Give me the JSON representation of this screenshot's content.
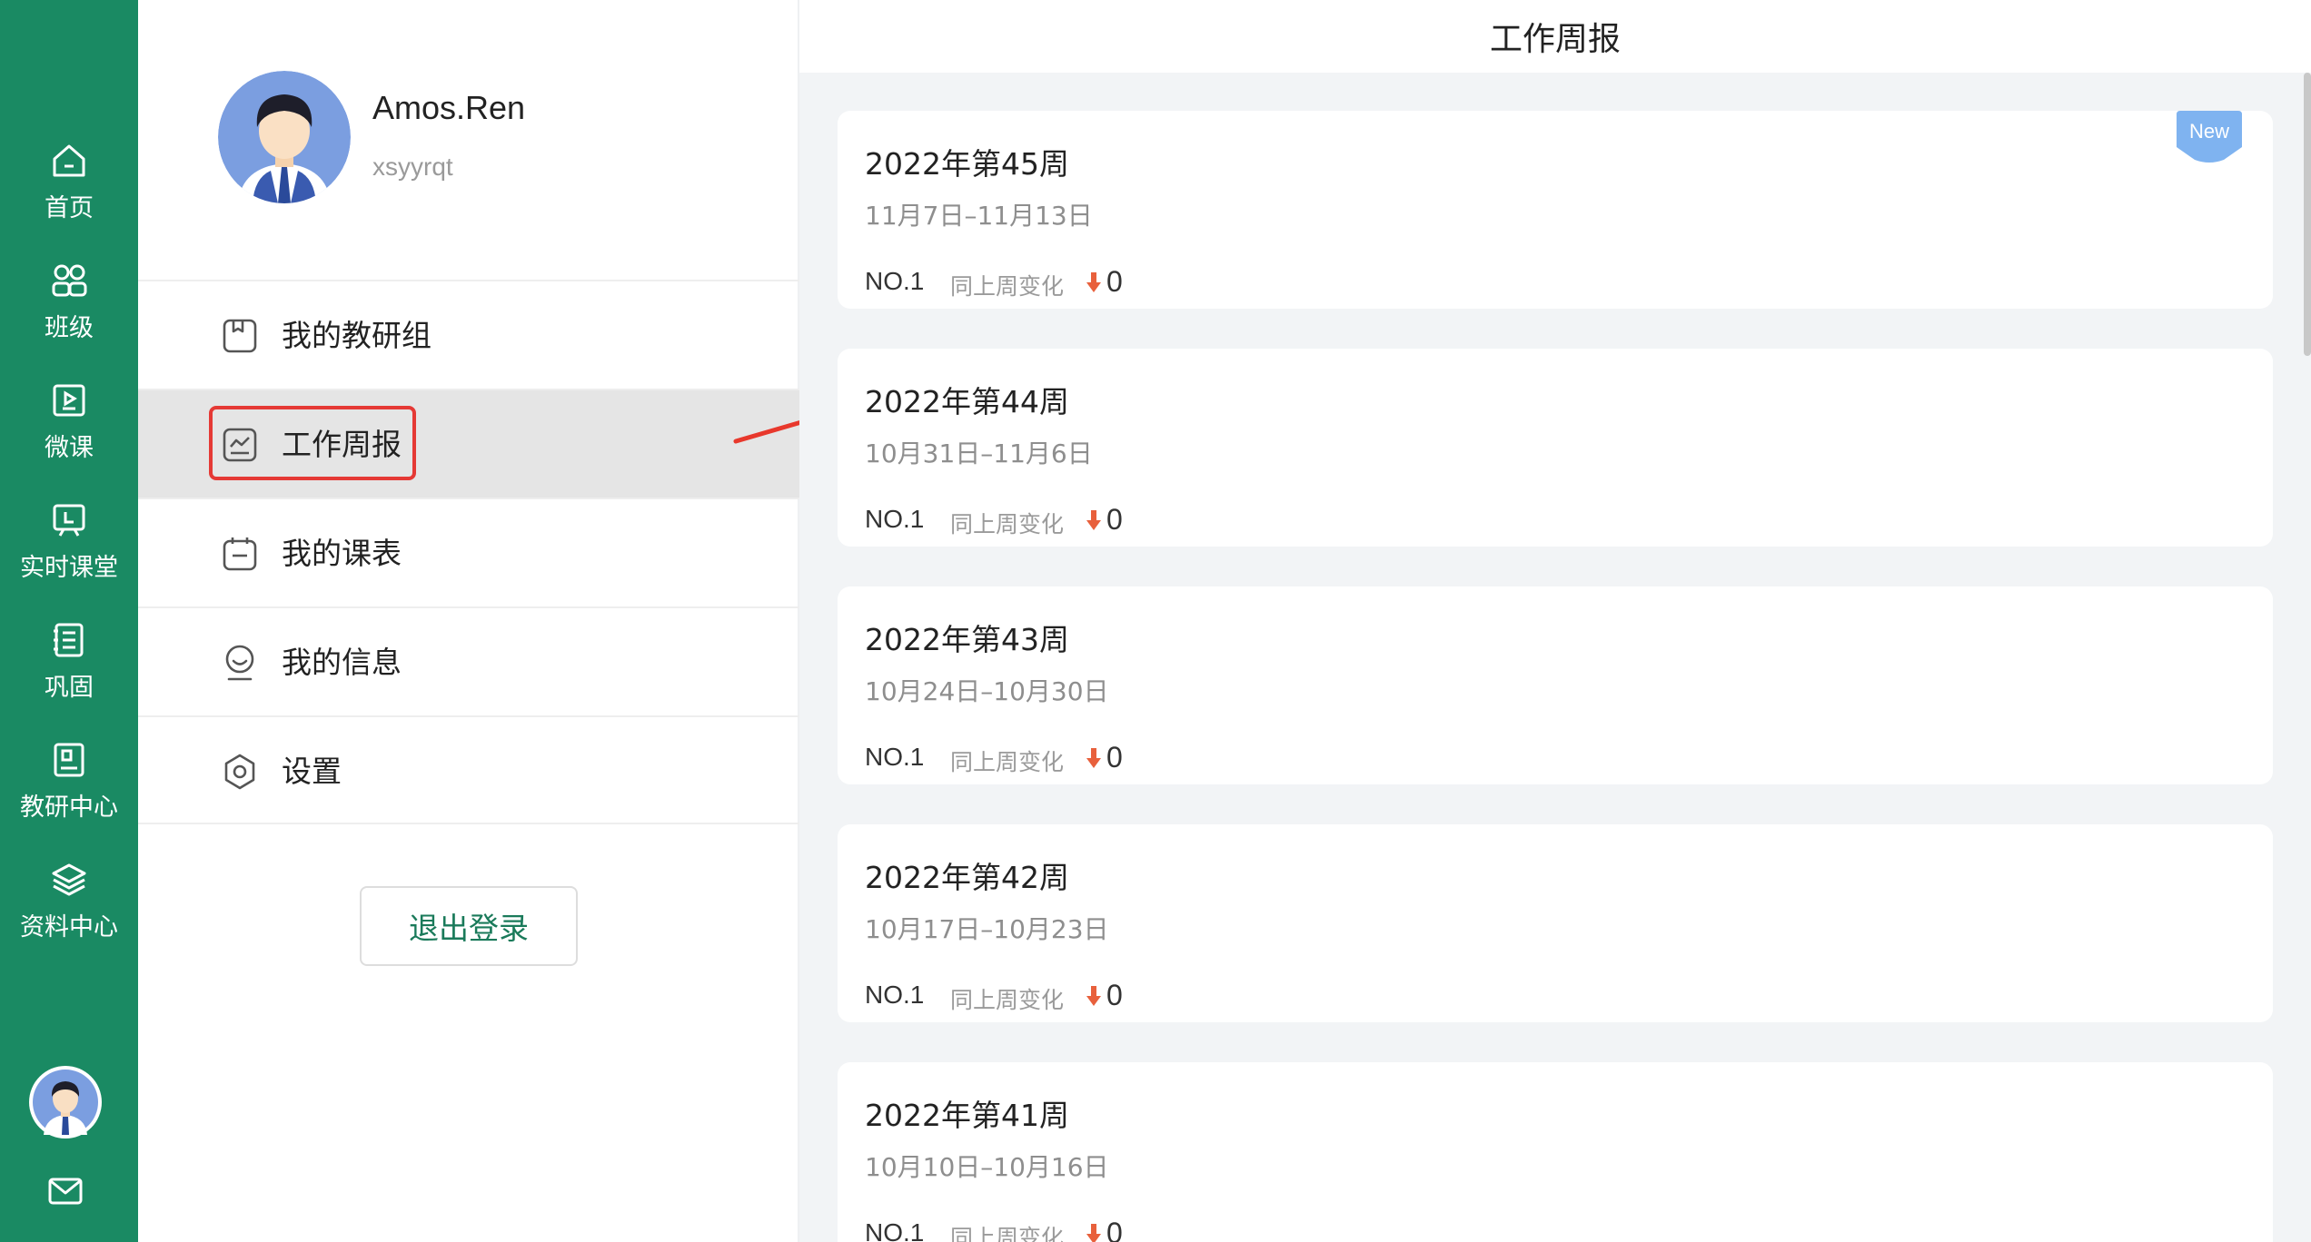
{
  "rail": {
    "items": [
      {
        "icon": "home-icon",
        "label": "首页"
      },
      {
        "icon": "class-icon",
        "label": "班级"
      },
      {
        "icon": "micro-lesson-icon",
        "label": "微课"
      },
      {
        "icon": "live-class-icon",
        "label": "实时课堂"
      },
      {
        "icon": "review-icon",
        "label": "巩固"
      },
      {
        "icon": "research-center-icon",
        "label": "教研中心"
      },
      {
        "icon": "resource-center-icon",
        "label": "资料中心"
      }
    ]
  },
  "profile": {
    "name": "Amos.Ren",
    "account": "xsyyrqt"
  },
  "menu": {
    "items": [
      {
        "icon": "research-group-icon",
        "label": "我的教研组"
      },
      {
        "icon": "weekly-report-icon",
        "label": "工作周报"
      },
      {
        "icon": "schedule-icon",
        "label": "我的课表"
      },
      {
        "icon": "user-info-icon",
        "label": "我的信息"
      },
      {
        "icon": "settings-icon",
        "label": "设置"
      }
    ],
    "active_index": 1
  },
  "logout_label": "退出登录",
  "content": {
    "title": "工作周报",
    "new_badge": "New",
    "change_label": "同上周变化",
    "reports": [
      {
        "title": "2022年第45周",
        "range": "11月7日–11月13日",
        "rank": "NO.1",
        "change": "0"
      },
      {
        "title": "2022年第44周",
        "range": "10月31日–11月6日",
        "rank": "NO.1",
        "change": "0"
      },
      {
        "title": "2022年第43周",
        "range": "10月24日–10月30日",
        "rank": "NO.1",
        "change": "0"
      },
      {
        "title": "2022年第42周",
        "range": "10月17日–10月23日",
        "rank": "NO.1",
        "change": "0"
      },
      {
        "title": "2022年第41周",
        "range": "10月10日–10月16日",
        "rank": "NO.1",
        "change": "0"
      }
    ]
  },
  "colors": {
    "rail": "#1a8a63",
    "accent_green": "#1a7a5a",
    "highlight_red": "#e53935",
    "down_arrow": "#e8603c",
    "new_badge": "#7fb3f0"
  }
}
